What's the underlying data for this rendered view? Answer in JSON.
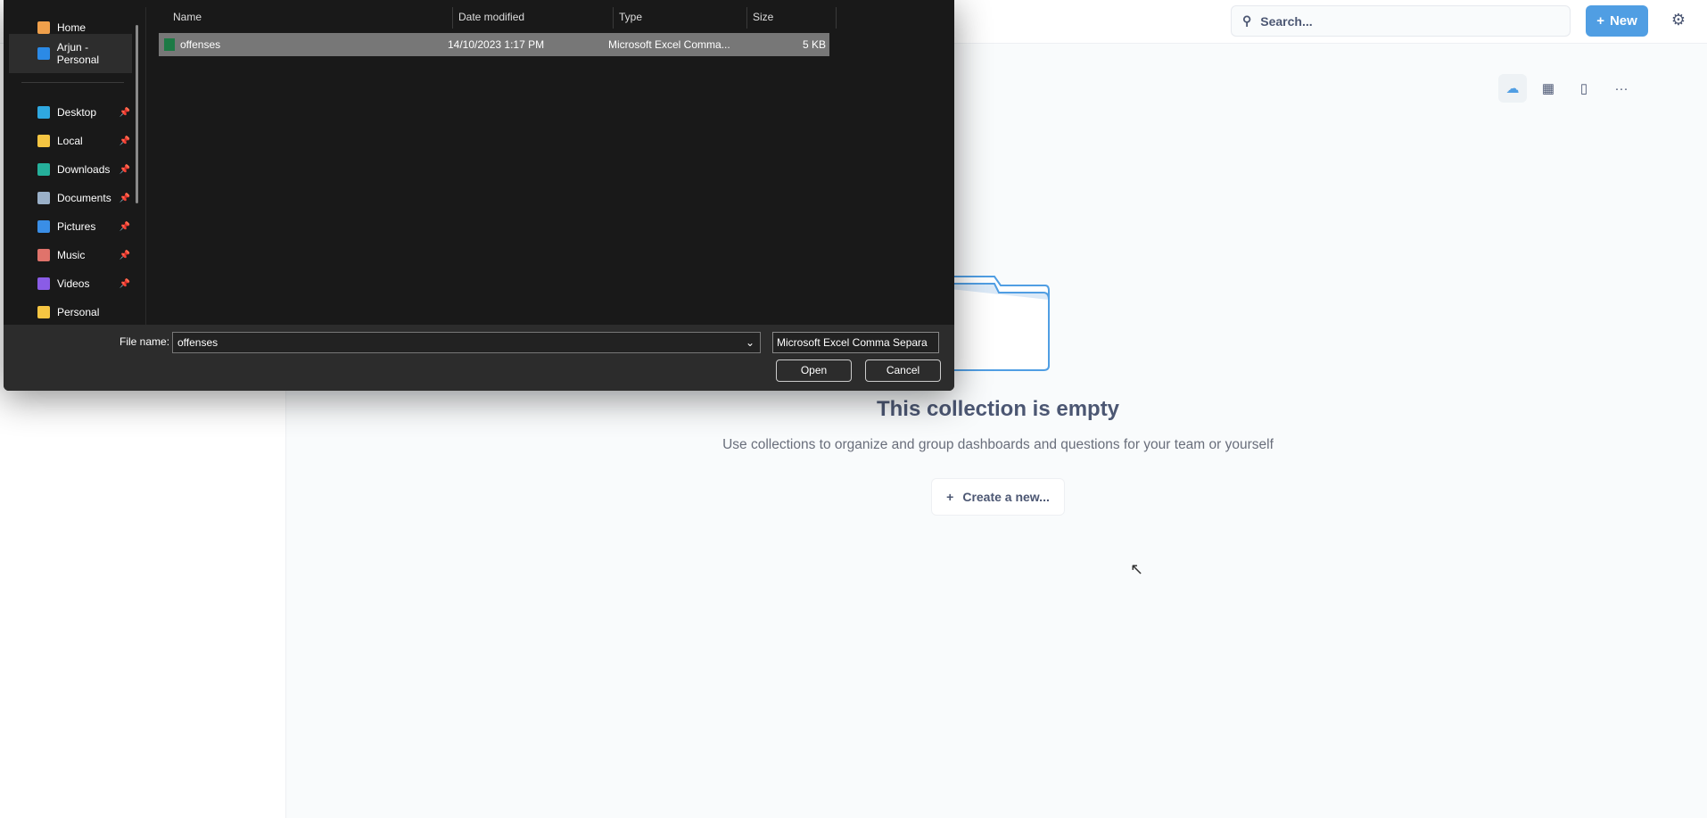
{
  "app": {
    "search_placeholder": "Search...",
    "new_label": "New",
    "icons": {
      "search": "search-icon",
      "gear": "gear-icon",
      "upload": "cloud-upload-icon",
      "calendar": "calendar-icon",
      "bookmark": "bookmark-icon",
      "more": "more-icon"
    },
    "accent": "#509ee3"
  },
  "empty_state": {
    "title": "This collection is empty",
    "subtitle": "Use collections to organize and group dashboards and questions for your team or yourself",
    "create_label": "Create a new..."
  },
  "dialog": {
    "nav": [
      {
        "label": "Home",
        "icon": "home-icon",
        "color": "#f0a04b"
      },
      {
        "label": "Arjun - Personal",
        "icon": "onedrive-icon",
        "color": "#2b8ae6"
      },
      {
        "label": "Desktop",
        "icon": "desktop-icon",
        "color": "#2fa8e0",
        "pinned": true
      },
      {
        "label": "Local",
        "icon": "folder-icon",
        "color": "#f5c542",
        "pinned": true
      },
      {
        "label": "Downloads",
        "icon": "download-icon",
        "color": "#25b09b",
        "pinned": true
      },
      {
        "label": "Documents",
        "icon": "documents-icon",
        "color": "#9ab0c8",
        "pinned": true
      },
      {
        "label": "Pictures",
        "icon": "pictures-icon",
        "color": "#3a8ee6",
        "pinned": true
      },
      {
        "label": "Music",
        "icon": "music-icon",
        "color": "#e0736b",
        "pinned": true
      },
      {
        "label": "Videos",
        "icon": "videos-icon",
        "color": "#8a5ce6",
        "pinned": true
      },
      {
        "label": "Personal",
        "icon": "folder-icon",
        "color": "#f5c542"
      }
    ],
    "columns": [
      "Name",
      "Date modified",
      "Type",
      "Size"
    ],
    "files": [
      {
        "name": "offenses",
        "date": "14/10/2023 1:17 PM",
        "type": "Microsoft Excel Comma...",
        "size": "5 KB"
      }
    ],
    "file_name_label": "File name:",
    "file_name_value": "offenses",
    "filter_value": "Microsoft Excel Comma Separa",
    "open_label": "Open",
    "cancel_label": "Cancel"
  }
}
